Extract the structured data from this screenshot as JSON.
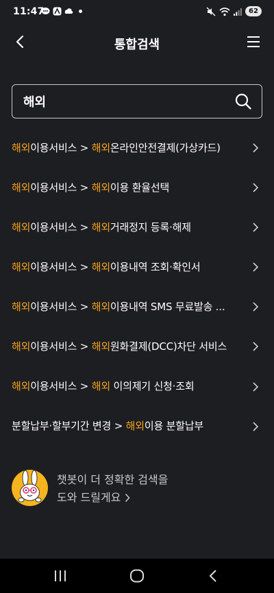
{
  "status_bar": {
    "time": "11:47",
    "battery": "62"
  },
  "header": {
    "title": "통합검색"
  },
  "search": {
    "value": "해외"
  },
  "results": [
    {
      "hl": "해외",
      "mid": "이용서비스 > ",
      "hl2": "해외",
      "rest": "온라인안전결제(가상카드)"
    },
    {
      "hl": "해외",
      "mid": "이용서비스 > ",
      "hl2": "해외",
      "rest": "이용 환율선택"
    },
    {
      "hl": "해외",
      "mid": "이용서비스 > ",
      "hl2": "해외",
      "rest": "거래정지 등록·해제"
    },
    {
      "hl": "해외",
      "mid": "이용서비스 > ",
      "hl2": "해외",
      "rest": "이용내역 조회·확인서"
    },
    {
      "hl": "해외",
      "mid": "이용서비스 > ",
      "hl2": "해외",
      "rest": "이용내역 SMS 무료발송 ..."
    },
    {
      "hl": "해외",
      "mid": "이용서비스 > ",
      "hl2": "해외",
      "rest": "원화결제(DCC)차단 서비스"
    },
    {
      "hl": "해외",
      "mid": "이용서비스 > ",
      "hl2": "해외",
      "rest": " 이의제기 신청·조회"
    },
    {
      "pre": "분할납부·할부기간 변경 > ",
      "hl2": "해외",
      "rest": "이용 분할납부"
    }
  ],
  "chatbot": {
    "line1": "챗봇이 더 정확한 검색을",
    "line2": "도와 드릴게요"
  },
  "colors": {
    "highlight": "#f5a31a",
    "background": "#1d1e22"
  },
  "icons": {
    "back": "chevron-left-icon",
    "menu": "hamburger-icon",
    "search": "search-icon",
    "row": "chevron-right-icon",
    "nav_recent": "recent-apps-icon",
    "nav_home": "home-icon",
    "nav_back": "back-icon"
  }
}
